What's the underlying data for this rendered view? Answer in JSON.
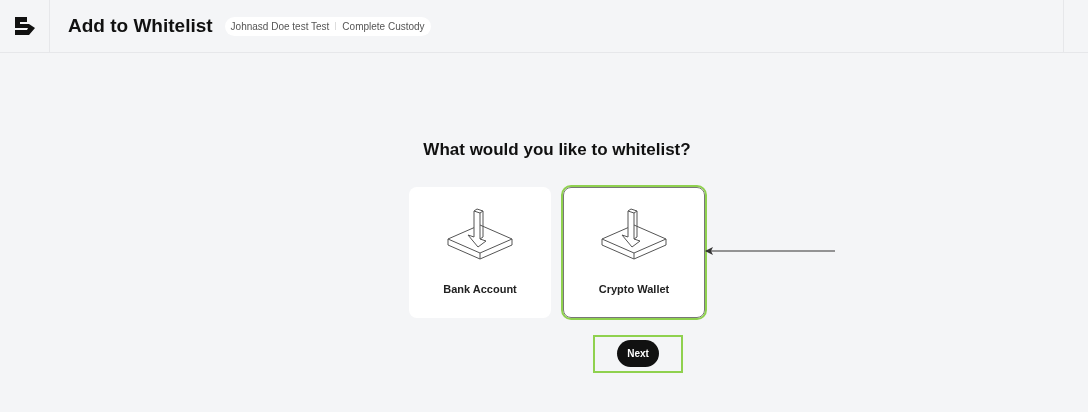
{
  "header": {
    "title": "Add to Whitelist",
    "breadcrumbs": [
      "Johnasd Doe test Test",
      "Complete Custody"
    ]
  },
  "question": "What would you like to whitelist?",
  "options": [
    {
      "label": "Bank Account",
      "selected": false
    },
    {
      "label": "Crypto Wallet",
      "selected": true
    }
  ],
  "next_button": "Next"
}
